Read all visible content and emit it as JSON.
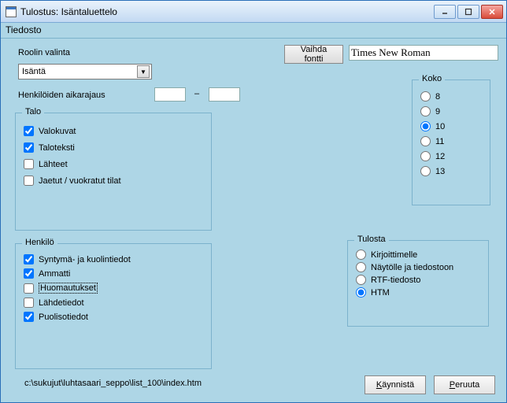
{
  "window": {
    "title": "Tulostus: Isäntaluettelo"
  },
  "menu": {
    "file": "Tiedosto"
  },
  "role": {
    "label": "Roolin valinta",
    "value": "Isäntä"
  },
  "dateRange": {
    "label": "Henkilöiden aikarajaus",
    "from": "",
    "to": "",
    "sep": "–"
  },
  "font": {
    "button": "Vaihda fontti",
    "value": "Times New Roman"
  },
  "koko": {
    "legend": "Koko",
    "options": [
      "8",
      "9",
      "10",
      "11",
      "12",
      "13"
    ],
    "selected": "10"
  },
  "talo": {
    "legend": "Talo",
    "items": [
      {
        "label": "Valokuvat",
        "checked": true
      },
      {
        "label": "Taloteksti",
        "checked": true
      },
      {
        "label": "Lähteet",
        "checked": false
      },
      {
        "label": "Jaetut / vuokratut tilat",
        "checked": false
      }
    ]
  },
  "henkilo": {
    "legend": "Henkilö",
    "items": [
      {
        "label": "Syntymä- ja kuolintiedot",
        "checked": true
      },
      {
        "label": "Ammatti",
        "checked": true
      },
      {
        "label": "Huomautukset",
        "checked": false,
        "focus": true
      },
      {
        "label": "Lähdetiedot",
        "checked": false
      },
      {
        "label": "Puolisotiedot",
        "checked": true
      }
    ]
  },
  "tulosta": {
    "legend": "Tulosta",
    "options": [
      {
        "label": "Kirjoittimelle"
      },
      {
        "label": "Näytölle ja tiedostoon"
      },
      {
        "label": "RTF-tiedosto"
      },
      {
        "label": "HTM"
      }
    ],
    "selected": "HTM"
  },
  "path": "c:\\sukujut\\luhtasaari_seppo\\list_100\\index.htm",
  "buttons": {
    "start": "Käynnistä",
    "cancel": "Peruuta"
  }
}
